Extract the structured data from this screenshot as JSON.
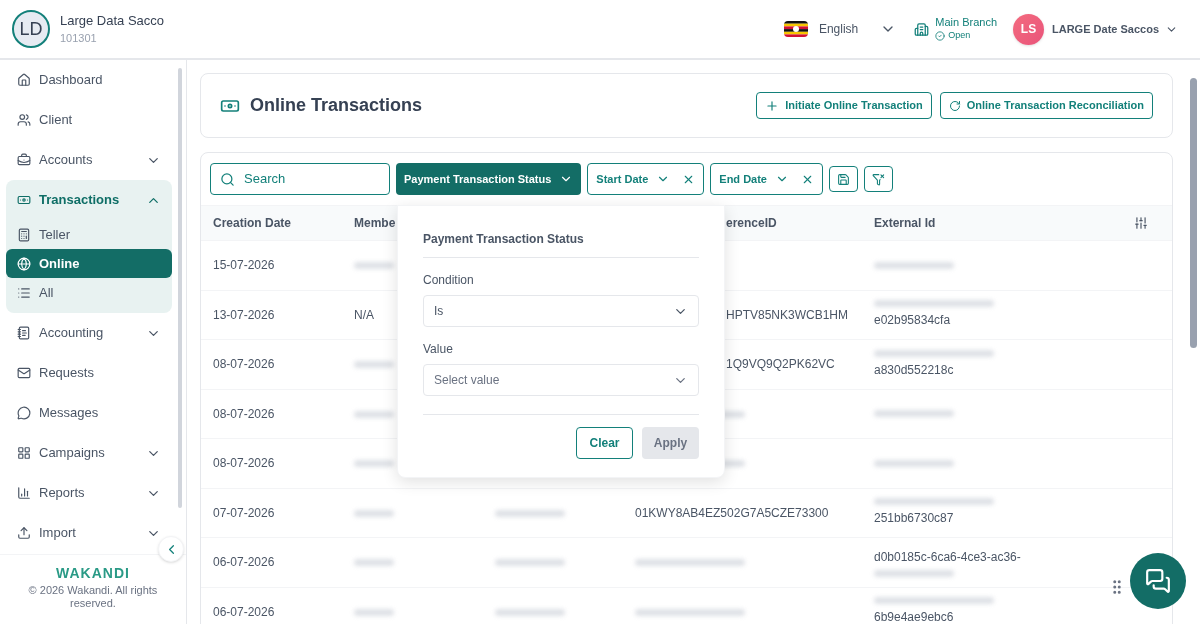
{
  "org": {
    "initials": "LD",
    "name": "Large Data Sacco",
    "code": "101301"
  },
  "topbar": {
    "language": "English",
    "branch": {
      "name": "Main Branch",
      "status": "Open"
    },
    "user": {
      "initials": "LS",
      "name": "LARGE Date Saccos"
    }
  },
  "sidebar": {
    "items": [
      {
        "label": "Dashboard",
        "selected": false
      },
      {
        "label": "Client",
        "selected": false
      },
      {
        "label": "Accounts",
        "selected": false,
        "expanded": false
      },
      {
        "label": "Transactions",
        "selected": true,
        "expanded": true,
        "children": [
          {
            "label": "Teller",
            "selected": false
          },
          {
            "label": "Online",
            "selected": true
          },
          {
            "label": "All",
            "selected": false
          }
        ]
      },
      {
        "label": "Accounting",
        "selected": false,
        "expanded": false
      },
      {
        "label": "Requests",
        "selected": false
      },
      {
        "label": "Messages",
        "selected": false
      },
      {
        "label": "Campaigns",
        "selected": false,
        "expanded": false
      },
      {
        "label": "Reports",
        "selected": false,
        "expanded": false
      },
      {
        "label": "Import",
        "selected": false,
        "expanded": false
      }
    ],
    "footer": {
      "logo": "WAKANDI",
      "copyright": "© 2026 Wakandi. All rights reserved."
    }
  },
  "page": {
    "title": "Online Transactions",
    "buttons": [
      "Initiate Online Transaction",
      "Online Transaction Reconciliation"
    ]
  },
  "filters": {
    "search_placeholder": "Search",
    "chips": [
      {
        "label": "Payment Transaction Status",
        "selected": true,
        "clearable": false
      },
      {
        "label": "Start Date",
        "selected": false,
        "clearable": true
      },
      {
        "label": "End Date",
        "selected": false,
        "clearable": true
      }
    ]
  },
  "popover": {
    "title": "Payment Transaction Status",
    "condition_label": "Condition",
    "condition_value": "Is",
    "value_label": "Value",
    "value_placeholder": "Select value",
    "buttons": [
      {
        "label": "Clear",
        "disabled": false
      },
      {
        "label": "Apply",
        "disabled": true
      }
    ]
  },
  "table": {
    "columns": [
      "Creation Date",
      "Membe",
      "erenceID",
      "External Id"
    ],
    "rows": [
      {
        "date": "15-07-2026"
      },
      {
        "date": "13-07-2026",
        "member": "N/A",
        "reference": "HPTV85NK3WCB1HM",
        "reference_covered": true,
        "external": "e02b95834cfa"
      },
      {
        "date": "08-07-2026",
        "reference": "1Q9VQ9Q2PK62VC",
        "reference_covered": true,
        "external": "a830d552218c"
      },
      {
        "date": "08-07-2026"
      },
      {
        "date": "08-07-2026"
      },
      {
        "date": "07-07-2026",
        "reference": "01KWY8AB4EZ502G7A5CZE73300",
        "reference_covered": false,
        "external": "251bb6730c87"
      },
      {
        "date": "06-07-2026",
        "external_top": "d0b0185c-6ca6-4ce3-ac36-"
      },
      {
        "date": "06-07-2026",
        "external": "6b9e4ae9ebc6"
      }
    ]
  }
}
